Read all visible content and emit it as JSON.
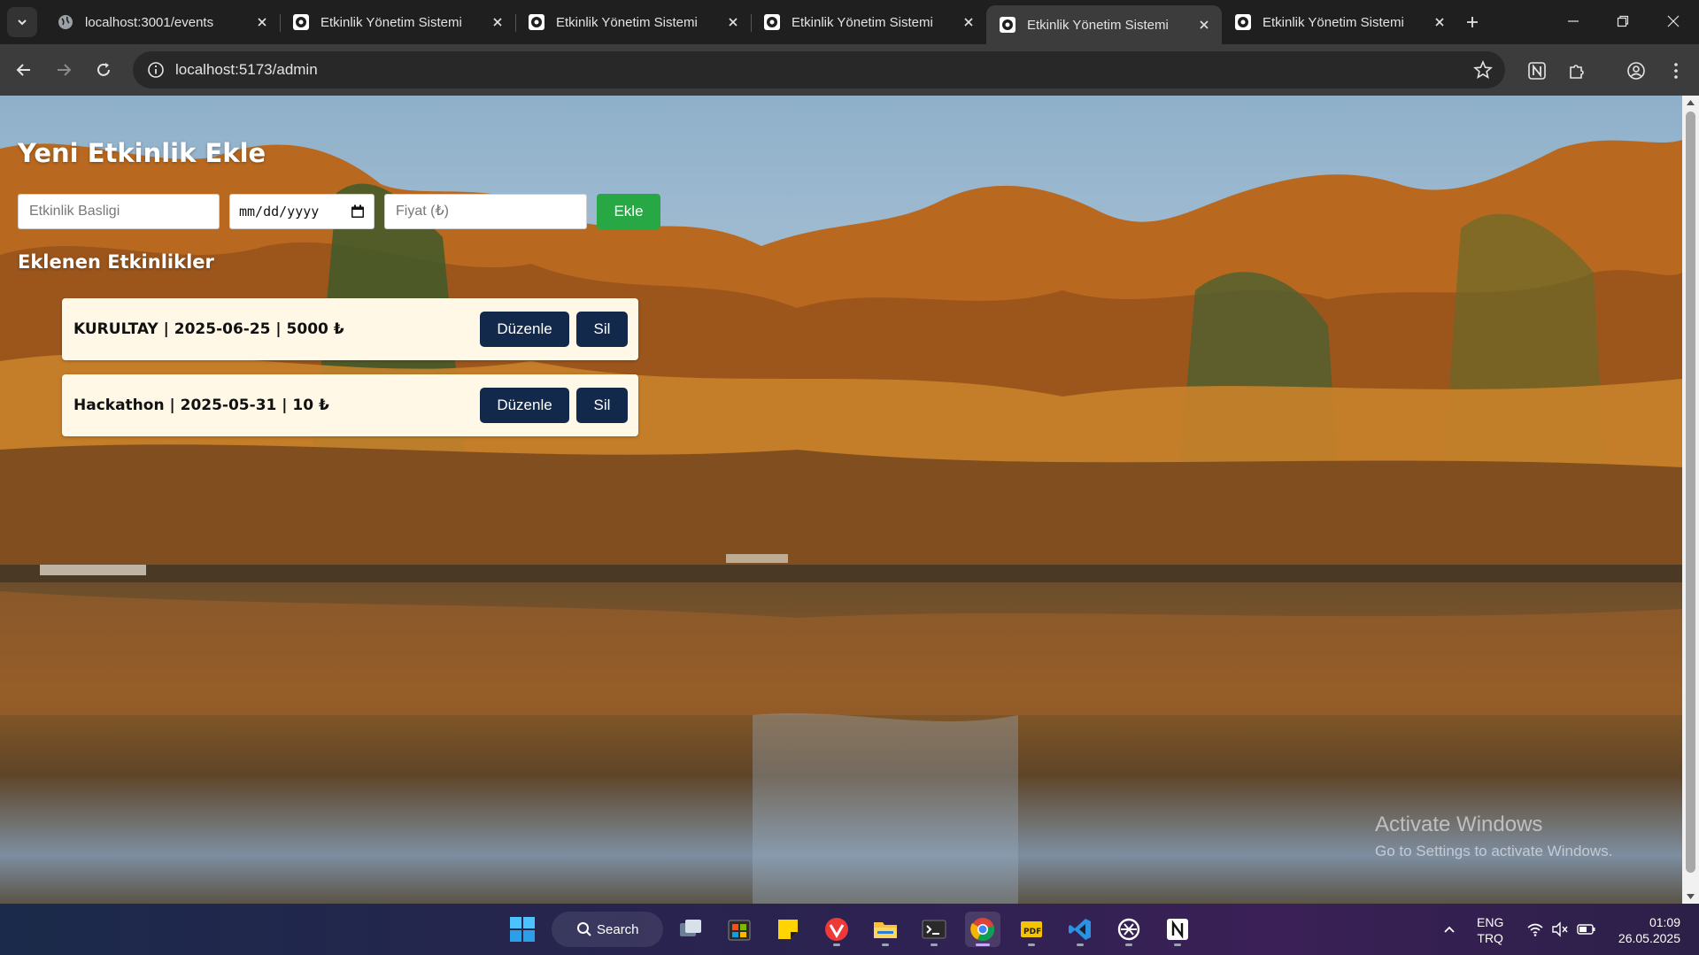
{
  "browser": {
    "tabs": [
      {
        "title": "localhost:3001/events",
        "active": false
      },
      {
        "title": "Etkinlik Yönetim Sistemi",
        "active": false
      },
      {
        "title": "Etkinlik Yönetim Sistemi",
        "active": false
      },
      {
        "title": "Etkinlik Yönetim Sistemi",
        "active": false
      },
      {
        "title": "Etkinlik Yönetim Sistemi",
        "active": true
      },
      {
        "title": "Etkinlik Yönetim Sistemi",
        "active": false
      }
    ],
    "url": "localhost:5173/admin"
  },
  "page": {
    "heading": "Yeni Etkinlik Ekle",
    "form": {
      "title_placeholder": "Etkinlik Basligi",
      "date_placeholder": "mm/dd/yyyy",
      "price_placeholder": "Fiyat (₺)",
      "add_label": "Ekle"
    },
    "list_heading": "Eklenen Etkinlikler",
    "events": [
      {
        "text": "KURULTAY | 2025-06-25 | 5000 ₺",
        "edit_label": "Düzenle",
        "delete_label": "Sil"
      },
      {
        "text": "Hackathon | 2025-05-31 | 10 ₺",
        "edit_label": "Düzenle",
        "delete_label": "Sil"
      }
    ],
    "colors": {
      "add_button": "#28a745",
      "action_button": "#13294b",
      "card_bg": "#fff8e7"
    }
  },
  "watermark": {
    "line1": "Activate Windows",
    "line2": "Go to Settings to activate Windows."
  },
  "taskbar": {
    "search_label": "Search",
    "apps": [
      "windows-start-icon",
      "task-view-icon",
      "store-icon",
      "sticky-notes-icon",
      "vivaldi-icon",
      "file-explorer-icon",
      "terminal-icon",
      "chrome-icon",
      "pdf-app-icon",
      "vscode-icon",
      "chatgpt-icon",
      "notion-icon"
    ],
    "lang_line1": "ENG",
    "lang_line2": "TRQ",
    "time": "01:09",
    "date": "26.05.2025"
  }
}
